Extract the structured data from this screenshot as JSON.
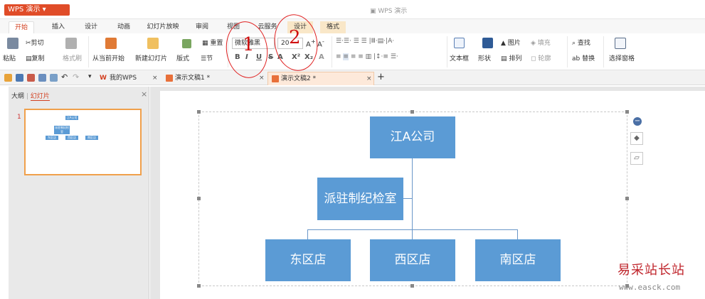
{
  "app": {
    "button_label": "WPS 演示",
    "window_title": "WPS 演示"
  },
  "menu_tabs": [
    "开始",
    "插入",
    "设计",
    "动画",
    "幻灯片放映",
    "审阅",
    "视图",
    "云服务",
    "设计",
    "格式"
  ],
  "ribbon": {
    "paste": "粘贴",
    "cut": "剪切",
    "copy": "复制",
    "format_painter": "格式刷",
    "from_current": "从当前开始",
    "new_slide": "新建幻灯片",
    "layout": "版式",
    "section": "节",
    "reset": "重置",
    "font_name": "微软雅黑",
    "font_size": "20",
    "text_box": "文本框",
    "shape": "形状",
    "picture": "图片",
    "fill": "填充",
    "arrange": "排列",
    "outline": "轮廓",
    "find": "查找",
    "replace": "替换",
    "selection_pane": "选择窗格"
  },
  "doc_tabs": [
    {
      "label": "我的WPS"
    },
    {
      "label": "演示文稿1 *"
    },
    {
      "label": "演示文稿2 *"
    }
  ],
  "left_panel": {
    "tab_outline": "大纲",
    "tab_slides": "幻灯片",
    "slide_number": "1"
  },
  "thumbnail": {
    "top": "江A公司",
    "mid": "派驻制纪检室",
    "b1": "东区店",
    "b2": "西区店",
    "b3": "南区店"
  },
  "orgchart": {
    "top": "江A公司",
    "assistant": "派驻制纪检室",
    "children": [
      "东区店",
      "西区店",
      "南区店"
    ]
  },
  "annotations": [
    "1",
    "2"
  ],
  "watermark": {
    "text": "易采站长站",
    "url": "www.easck.com"
  },
  "colors": {
    "accent": "#e04c28",
    "node": "#5b9bd5",
    "annotation": "#e02020"
  }
}
